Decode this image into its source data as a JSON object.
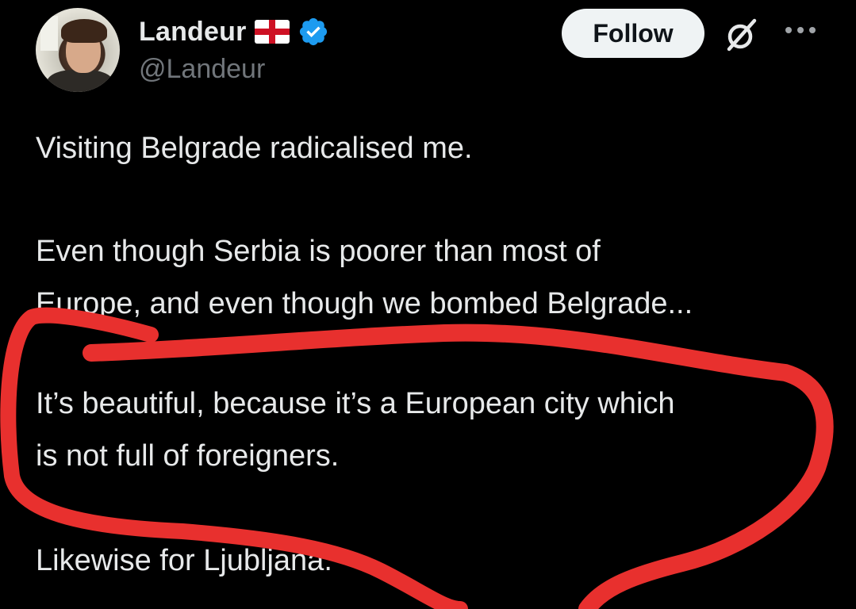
{
  "author": {
    "display_name": "Landeur",
    "handle": "@Landeur",
    "flag_icon": "england-flag-icon",
    "verified_icon": "verified-badge-icon",
    "verified_color": "#1d9bf0"
  },
  "actions": {
    "follow_label": "Follow",
    "grok_icon": "grok-icon",
    "more_icon": "more-options-icon"
  },
  "tweet": {
    "paragraphs": [
      [
        "Visiting Belgrade radicalised me."
      ],
      [
        "Even though Serbia is poorer than most of",
        "Europe, and even though we bombed Belgrade..."
      ],
      [
        "It’s beautiful, because it’s a European city which",
        "is not full of foreigners."
      ],
      [
        "Likewise for Ljubljana."
      ]
    ]
  },
  "annotation": {
    "type": "red-freehand-circle",
    "color": "#e8302e"
  },
  "colors": {
    "background": "#000000",
    "text_primary": "#e7e9ea",
    "text_secondary": "#71767b",
    "follow_bg": "#eff3f4"
  }
}
